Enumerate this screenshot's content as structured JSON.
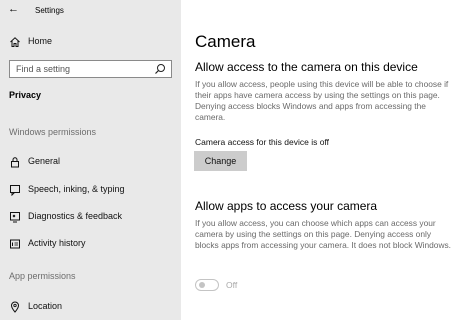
{
  "window": {
    "back_icon": "back-arrow-icon",
    "title": "Settings"
  },
  "sidebar": {
    "home_label": "Home",
    "search_placeholder": "Find a setting",
    "section_heading": "Privacy",
    "group_windows_permissions": "Windows permissions",
    "items": [
      {
        "label": "General",
        "icon": "lock-icon"
      },
      {
        "label": "Speech, inking, & typing",
        "icon": "speech-icon"
      },
      {
        "label": "Diagnostics & feedback",
        "icon": "diagnostics-icon"
      },
      {
        "label": "Activity history",
        "icon": "activity-history-icon"
      }
    ],
    "group_app_permissions": "App permissions",
    "app_items": [
      {
        "label": "Location",
        "icon": "location-icon"
      }
    ],
    "background_color": "#e9e9e9"
  },
  "main": {
    "page_title": "Camera",
    "section1": {
      "heading": "Allow access to the camera on this device",
      "description": "If you allow access, people using this device will be able to choose if their apps have camera access by using the settings on this page. Denying access blocks Windows and apps from accessing the camera.",
      "status": "Camera access for this device is off",
      "change_button": "Change"
    },
    "section2": {
      "heading": "Allow apps to access your camera",
      "description": "If you allow access, you can choose which apps can access your camera by using the settings on this page. Denying access only blocks apps from accessing your camera. It does not block Windows.",
      "toggle_state": "Off",
      "toggle_enabled": false
    }
  }
}
